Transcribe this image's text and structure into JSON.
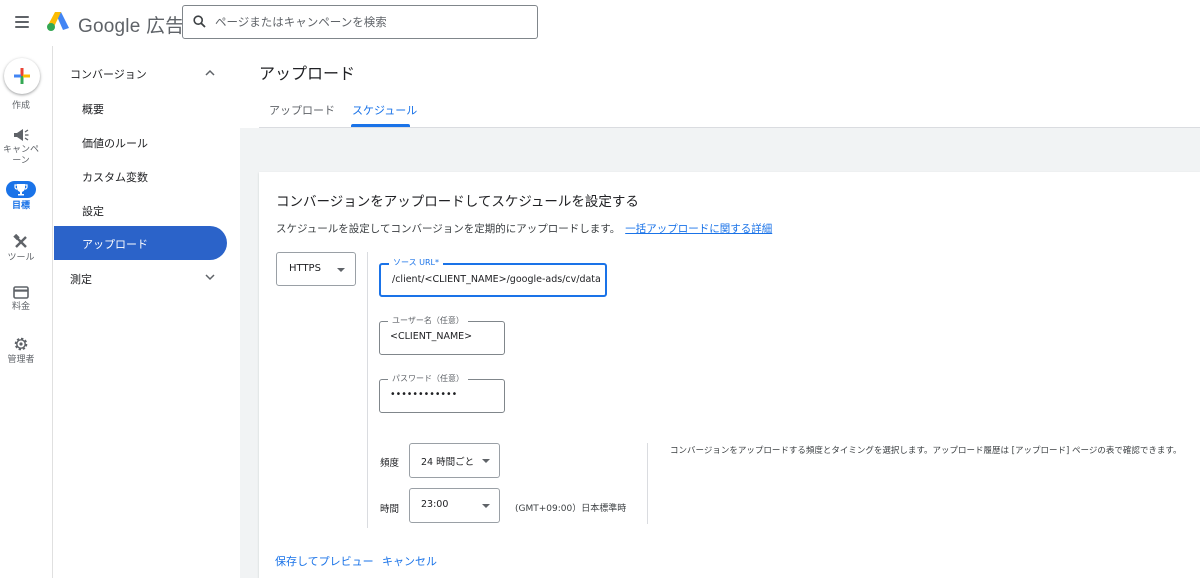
{
  "app": {
    "brand_suffix": "広告",
    "brand_name": "Google"
  },
  "search": {
    "placeholder": "ページまたはキャンペーンを検索",
    "value": ""
  },
  "rail": {
    "create_label": "作成",
    "campaigns_label": "キャンペーン",
    "goals_label": "目標",
    "tools_label": "ツール",
    "billing_label": "料金",
    "admin_label": "管理者",
    "active": "goals"
  },
  "subnav": {
    "section_conversions": "コンバージョン",
    "items": [
      "概要",
      "価値のルール",
      "カスタム変数",
      "設定",
      "アップロード"
    ],
    "active_item": "アップロード",
    "section_measurement": "測定"
  },
  "main": {
    "title": "アップロード",
    "tabs": [
      "アップロード",
      "スケジュール"
    ],
    "active_tab": "スケジュール"
  },
  "card": {
    "title": "コンバージョンをアップロードしてスケジュールを設定する",
    "description": "スケジュールを設定してコンバージョンを定期的にアップロードします。",
    "link": "一括アップロードに関する詳細",
    "protocol": "HTTPS",
    "source_url_label": "ソース URL*",
    "source_url_value": "/client/<CLIENT_NAME>/google-ads/cv/data.csv",
    "username_label": "ユーザー名（任意）",
    "username_value": "<CLIENT_NAME>",
    "password_label": "パスワード（任意）",
    "password_value": "••••••••••••",
    "frequency_label": "頻度",
    "frequency_value": "24 時間ごと",
    "time_label": "時間",
    "time_value": "23:00",
    "timezone": "(GMT+09:00）日本標準時",
    "help_text": "コンバージョンをアップロードする頻度とタイミングを選択します。アップロード履歴は [アップロード] ページの表で確認できます。",
    "save_preview": "保存してプレビュー",
    "cancel": "キャンセル"
  },
  "colors": {
    "accent": "#1a73e8",
    "active_nav": "#2b63c9",
    "background_gray": "#f1f3f4"
  }
}
